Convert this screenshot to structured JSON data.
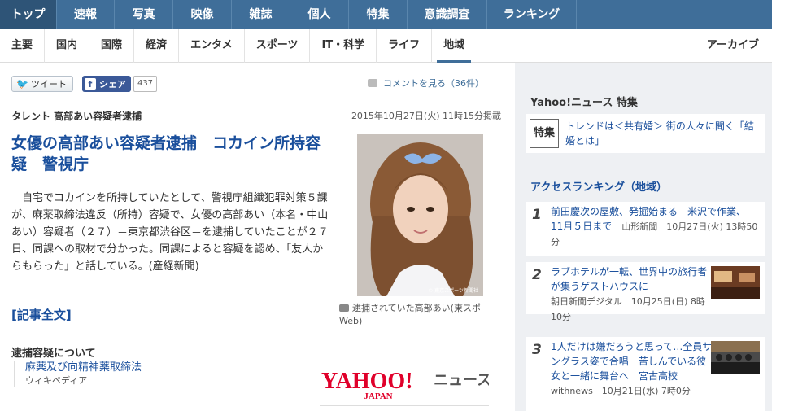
{
  "topnav": [
    "トップ",
    "速報",
    "写真",
    "映像",
    "雑誌",
    "個人",
    "特集",
    "意識調査",
    "ランキング"
  ],
  "subnav": [
    "主要",
    "国内",
    "国際",
    "経済",
    "エンタメ",
    "スポーツ",
    "IT・科学",
    "ライフ",
    "地域"
  ],
  "subnav_archive": "アーカイブ",
  "share": {
    "tweet": "ツイート",
    "fb": "シェア",
    "fb_count": "437",
    "comments": "コメントを見る（36件）"
  },
  "article": {
    "category": "タレント 高部あい容疑者逮捕",
    "date": "2015年10月27日(火) 11時15分掲載",
    "headline": "女優の高部あい容疑者逮捕　コカイン所持容疑　警視庁",
    "body": "　自宅でコカインを所持していたとして、警視庁組織犯罪対策５課が、麻薬取締法違反（所持）容疑で、女優の高部あい（本名・中山あい）容疑者（２７）＝東京都渋谷区＝を逮捕していたことが２７日、同課への取材で分かった。同課によると容疑を認め、「友人からもらった」と話している。(産経新聞)",
    "fulltext": "[記事全文]",
    "caption": "逮捕されていた高部あい(東スポWeb)",
    "photo_credit": "© 東京スポーツ新聞社"
  },
  "related": {
    "heading": "逮捕容疑について",
    "link": "麻薬及び向精神薬取締法",
    "source": "ウィキペディア"
  },
  "logo": {
    "yahoo": "YAHOO!",
    "japan": "JAPAN",
    "news": "ニュース"
  },
  "sidebar": {
    "feature_heading": "Yahoo!ニュース 特集",
    "feature_badge": "特集",
    "feature_link": "トレンドは＜共有婚＞ 街の人々に聞く「結婚とは」",
    "ranking_heading": "アクセスランキング（地域）",
    "ranking": [
      {
        "num": "1",
        "title": "前田慶次の屋敷、発掘始まる　米沢で作業、11月５日まで",
        "meta": "山形新聞　10月27日(火) 13時50分"
      },
      {
        "num": "2",
        "title": "ラブホテルが一転、世界中の旅行者が集うゲストハウスに",
        "meta": "朝日新聞デジタル　10月25日(日) 8時10分"
      },
      {
        "num": "3",
        "title": "1人だけは嫌だろうと思って…全員サングラス姿で合唱　苦しんでいる彼女と一緒に舞台へ　宮古高校",
        "meta": "withnews　10月21日(水) 7時0分"
      }
    ]
  }
}
